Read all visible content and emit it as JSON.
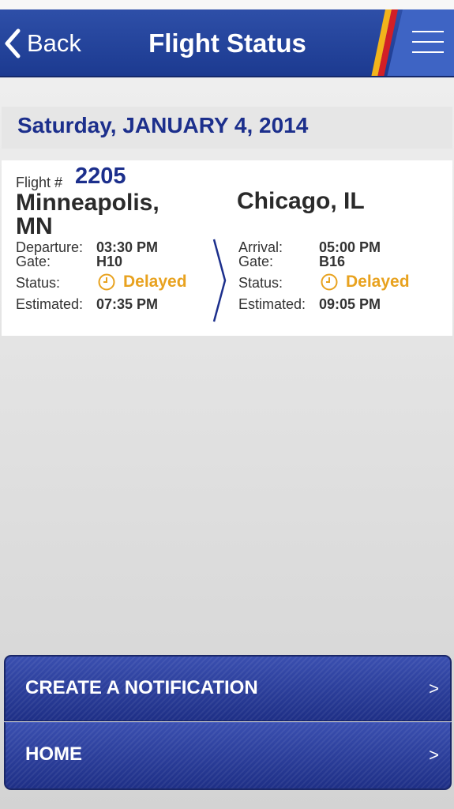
{
  "navbar": {
    "back_label": "Back",
    "title": "Flight Status"
  },
  "date_header": "Saturday, JANUARY 4, 2014",
  "flight": {
    "label": "Flight #",
    "number": "2205",
    "departure": {
      "city": "Minneapolis, MN",
      "time_label": "Departure:",
      "time": "03:30 PM",
      "gate_label": "Gate:",
      "gate": "H10",
      "status_label": "Status:",
      "status": "Delayed",
      "estimated_label": "Estimated:",
      "estimated": "07:35 PM"
    },
    "arrival": {
      "city": "Chicago, IL",
      "time_label": "Arrival:",
      "time": "05:00 PM",
      "gate_label": "Gate:",
      "gate": "B16",
      "status_label": "Status:",
      "status": "Delayed",
      "estimated_label": "Estimated:",
      "estimated": "09:05 PM"
    }
  },
  "actions": {
    "notify_label": "CREATE A NOTIFICATION",
    "home_label": "HOME",
    "chevron": ">"
  },
  "colors": {
    "brand_blue": "#1c2f8c",
    "delayed": "#e8a21f",
    "stripe_red": "#d21f26",
    "stripe_yellow": "#f2b41b"
  },
  "icons": [
    "chevron-left-icon",
    "hamburger-menu-icon",
    "clock-icon",
    "chevron-right-icon"
  ]
}
